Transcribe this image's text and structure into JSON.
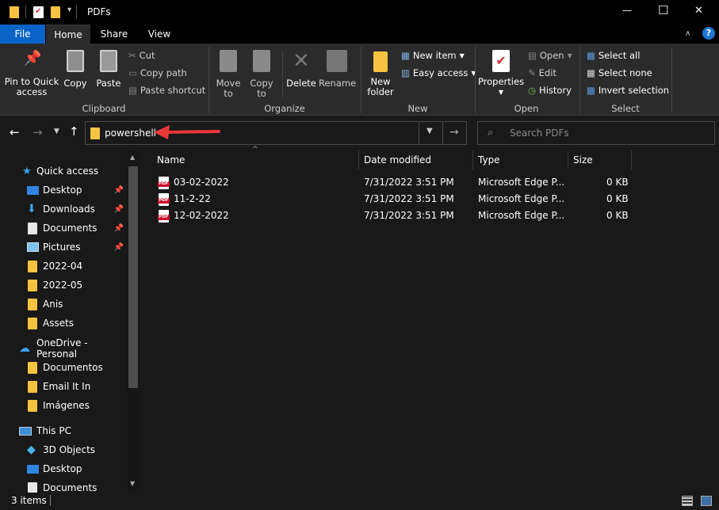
{
  "window": {
    "title": "PDFs",
    "minimize_glyph": "—",
    "maximize_glyph": "☐",
    "close_glyph": "✕"
  },
  "tabs": [
    {
      "label": "File"
    },
    {
      "label": "Home"
    },
    {
      "label": "Share"
    },
    {
      "label": "View"
    }
  ],
  "ribbon": {
    "clipboard": {
      "group_label": "Clipboard",
      "pin_label": "Pin to Quick access",
      "copy_label": "Copy",
      "paste_label": "Paste",
      "cut_label": "Cut",
      "copy_path_label": "Copy path",
      "paste_shortcut_label": "Paste shortcut"
    },
    "organize": {
      "group_label": "Organize",
      "move_to_label": "Move to",
      "copy_to_label": "Copy to",
      "delete_label": "Delete",
      "rename_label": "Rename"
    },
    "new": {
      "group_label": "New",
      "new_folder_label": "New folder",
      "new_item_label": "New item",
      "easy_access_label": "Easy access"
    },
    "open": {
      "group_label": "Open",
      "properties_label": "Properties",
      "open_label": "Open",
      "edit_label": "Edit",
      "history_label": "History"
    },
    "select": {
      "group_label": "Select",
      "select_all_label": "Select all",
      "select_none_label": "Select none",
      "invert_selection_label": "Invert selection"
    }
  },
  "address": {
    "path": "powershell",
    "search_placeholder": "Search PDFs"
  },
  "columns": [
    {
      "label": "Name"
    },
    {
      "label": "Date modified"
    },
    {
      "label": "Type"
    },
    {
      "label": "Size"
    }
  ],
  "files": [
    {
      "name": "03-02-2022",
      "date": "7/31/2022 3:51 PM",
      "type": "Microsoft Edge P...",
      "size": "0 KB"
    },
    {
      "name": "11-2-22",
      "date": "7/31/2022 3:51 PM",
      "type": "Microsoft Edge P...",
      "size": "0 KB"
    },
    {
      "name": "12-02-2022",
      "date": "7/31/2022 3:51 PM",
      "type": "Microsoft Edge P...",
      "size": "0 KB"
    }
  ],
  "nav": {
    "quick_access": "Quick access",
    "items": [
      "Desktop",
      "Downloads",
      "Documents",
      "Pictures",
      "2022-04",
      "2022-05",
      "Anis",
      "Assets"
    ],
    "onedrive": "OneDrive - Personal",
    "onedrive_items": [
      "Documentos",
      "Email It In",
      "Imágenes"
    ],
    "this_pc": "This PC",
    "pc_items": [
      "3D Objects",
      "Desktop",
      "Documents"
    ]
  },
  "status": {
    "items_count": "3 items"
  },
  "colors": {
    "accent": "#0a64c8",
    "annotation_arrow": "#e8383a",
    "folder": "#f5c242"
  }
}
